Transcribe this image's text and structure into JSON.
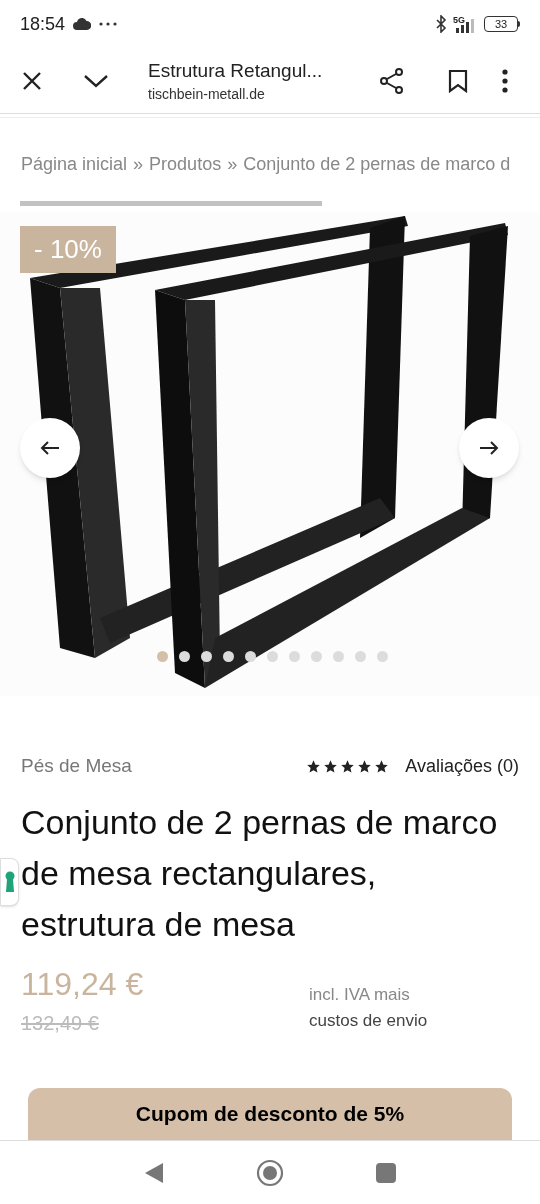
{
  "status_bar": {
    "time": "18:54",
    "network": "5G",
    "battery": "33"
  },
  "browser_bar": {
    "title": "Estrutura Retangul...",
    "domain": "tischbein-metall.de"
  },
  "breadcrumb": {
    "items": [
      "Página inicial",
      "Produtos",
      "Conjunto de 2 pernas de marco d"
    ],
    "separator": "»"
  },
  "gallery": {
    "badge": "- 10%",
    "dots": [
      {
        "selected": true
      },
      {
        "selected": false
      },
      {
        "selected": false
      },
      {
        "selected": false
      },
      {
        "selected": false
      },
      {
        "selected": false
      },
      {
        "selected": false
      },
      {
        "selected": false
      },
      {
        "selected": false
      },
      {
        "selected": false
      },
      {
        "selected": false
      }
    ]
  },
  "product": {
    "category": "Pés de Mesa",
    "stars": 5,
    "reviews": "Avaliações (0)",
    "title": "Conjunto de 2 pernas de marco de mesa rectangulares, estrutura de mesa",
    "price": "119,24 €",
    "old_price": "132,49 €",
    "tax_note": "incl. IVA mais",
    "shipping_link": "custos de envio"
  },
  "coupon": {
    "label": "Cupom de desconto de 5%"
  }
}
